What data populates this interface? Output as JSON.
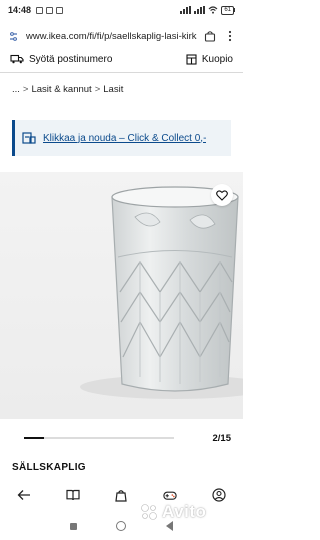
{
  "status_bar": {
    "time": "14:48",
    "battery": "61"
  },
  "browser": {
    "url": "www.ikea.com/fi/fi/p/saellskaplig-lasi-kirkas"
  },
  "location_bar": {
    "postcode_label": "Syötä postinumero",
    "store_label": "Kuopio"
  },
  "breadcrumb": {
    "ellipsis": "...",
    "separator": ">",
    "items": [
      "Lasit & kannut",
      "Lasit"
    ]
  },
  "promo": {
    "label": "Klikkaa ja nouda – Click & Collect 0,-"
  },
  "gallery": {
    "current": "2",
    "total": "15",
    "progress": 0.13
  },
  "product": {
    "name": "SÄLLSKAPLIG"
  },
  "bottom_nav": {
    "icons": [
      "back-icon",
      "book-icon",
      "bag-icon",
      "gamepad-icon",
      "account-icon"
    ]
  },
  "watermark": {
    "text": "Avito"
  },
  "colors": {
    "brand_blue": "#0b4a8c",
    "promo_bg": "#eef3f7"
  }
}
